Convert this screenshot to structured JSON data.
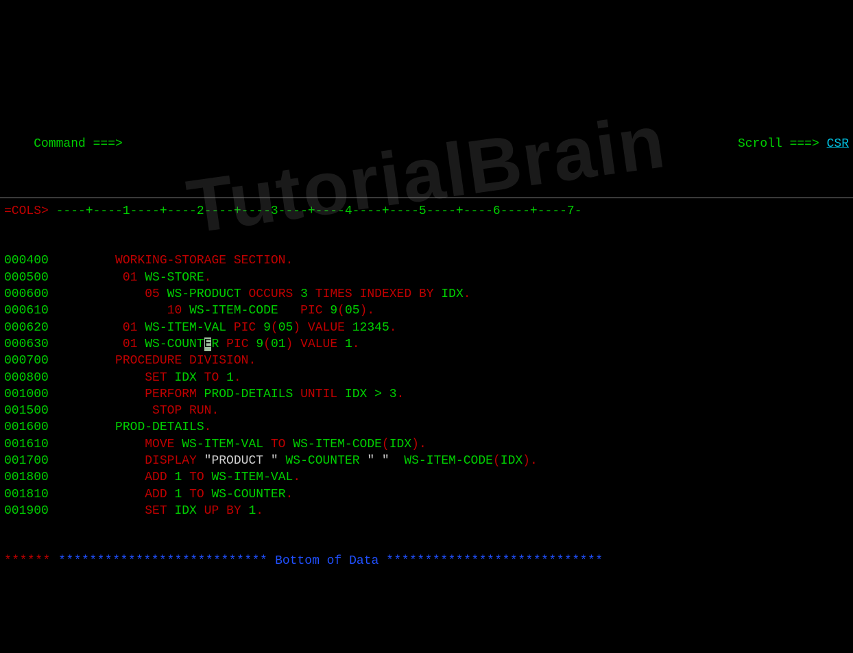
{
  "header": {
    "command_label": "Command ===>",
    "command_value": "",
    "scroll_label": "Scroll ===>",
    "scroll_value": "CSR"
  },
  "cols": {
    "prefix": "=COLS>",
    "ruler": " ----+----1----+----2----+----3----+----4----+----5----+----6----+----7-"
  },
  "lines": [
    {
      "ln": "000400",
      "code": [
        {
          "c": "red",
          "t": "       WORKING-STORAGE SECTION."
        }
      ]
    },
    {
      "ln": "000500",
      "code": [
        {
          "c": "red",
          "t": "        01 "
        },
        {
          "c": "green",
          "t": "WS-STORE"
        },
        {
          "c": "red",
          "t": "."
        }
      ]
    },
    {
      "ln": "000600",
      "code": [
        {
          "c": "red",
          "t": "           05 "
        },
        {
          "c": "green",
          "t": "WS-PRODUCT"
        },
        {
          "c": "red",
          "t": " OCCURS "
        },
        {
          "c": "green",
          "t": "3"
        },
        {
          "c": "red",
          "t": " TIMES INDEXED BY "
        },
        {
          "c": "green",
          "t": "IDX"
        },
        {
          "c": "red",
          "t": "."
        }
      ]
    },
    {
      "ln": "000610",
      "code": [
        {
          "c": "red",
          "t": "              10 "
        },
        {
          "c": "green",
          "t": "WS-ITEM-CODE"
        },
        {
          "c": "red",
          "t": "   PIC "
        },
        {
          "c": "green",
          "t": "9"
        },
        {
          "c": "red",
          "t": "("
        },
        {
          "c": "green",
          "t": "05"
        },
        {
          "c": "red",
          "t": ")."
        }
      ]
    },
    {
      "ln": "000620",
      "code": [
        {
          "c": "red",
          "t": "        01 "
        },
        {
          "c": "green",
          "t": "WS-ITEM-VAL"
        },
        {
          "c": "red",
          "t": " PIC "
        },
        {
          "c": "green",
          "t": "9"
        },
        {
          "c": "red",
          "t": "("
        },
        {
          "c": "green",
          "t": "05"
        },
        {
          "c": "red",
          "t": ") VALUE "
        },
        {
          "c": "green",
          "t": "12345"
        },
        {
          "c": "red",
          "t": "."
        }
      ]
    },
    {
      "ln": "000630",
      "code": [
        {
          "c": "red",
          "t": "        01 "
        },
        {
          "c": "green",
          "t": "WS-COUNT"
        },
        {
          "c": "cursor",
          "t": "E"
        },
        {
          "c": "green",
          "t": "R"
        },
        {
          "c": "red",
          "t": " PIC "
        },
        {
          "c": "green",
          "t": "9"
        },
        {
          "c": "red",
          "t": "("
        },
        {
          "c": "green",
          "t": "01"
        },
        {
          "c": "red",
          "t": ") VALUE "
        },
        {
          "c": "green",
          "t": "1"
        },
        {
          "c": "red",
          "t": "."
        }
      ]
    },
    {
      "ln": "000700",
      "code": [
        {
          "c": "red",
          "t": "       PROCEDURE DIVISION."
        }
      ]
    },
    {
      "ln": "000800",
      "code": [
        {
          "c": "red",
          "t": "           SET "
        },
        {
          "c": "green",
          "t": "IDX"
        },
        {
          "c": "red",
          "t": " TO "
        },
        {
          "c": "green",
          "t": "1"
        },
        {
          "c": "red",
          "t": "."
        }
      ]
    },
    {
      "ln": "001000",
      "code": [
        {
          "c": "red",
          "t": "           PERFORM "
        },
        {
          "c": "green",
          "t": "PROD-DETAILS"
        },
        {
          "c": "red",
          "t": " UNTIL "
        },
        {
          "c": "green",
          "t": "IDX > 3"
        },
        {
          "c": "red",
          "t": "."
        }
      ]
    },
    {
      "ln": "001500",
      "code": [
        {
          "c": "red",
          "t": "            STOP RUN."
        }
      ]
    },
    {
      "ln": "001600",
      "code": [
        {
          "c": "green",
          "t": "       PROD-DETAILS"
        },
        {
          "c": "red",
          "t": "."
        }
      ]
    },
    {
      "ln": "001610",
      "code": [
        {
          "c": "red",
          "t": "           MOVE "
        },
        {
          "c": "green",
          "t": "WS-ITEM-VAL"
        },
        {
          "c": "red",
          "t": " TO "
        },
        {
          "c": "green",
          "t": "WS-ITEM-CODE"
        },
        {
          "c": "red",
          "t": "("
        },
        {
          "c": "green",
          "t": "IDX"
        },
        {
          "c": "red",
          "t": ")."
        }
      ]
    },
    {
      "ln": "001700",
      "code": [
        {
          "c": "red",
          "t": "           DISPLAY "
        },
        {
          "c": "white",
          "t": "\"PRODUCT \""
        },
        {
          "c": "green",
          "t": " WS-COUNTER "
        },
        {
          "c": "white",
          "t": "\" \""
        },
        {
          "c": "green",
          "t": "  WS-ITEM-CODE"
        },
        {
          "c": "red",
          "t": "("
        },
        {
          "c": "green",
          "t": "IDX"
        },
        {
          "c": "red",
          "t": ")."
        }
      ]
    },
    {
      "ln": "001800",
      "code": [
        {
          "c": "red",
          "t": "           ADD "
        },
        {
          "c": "green",
          "t": "1"
        },
        {
          "c": "red",
          "t": " TO "
        },
        {
          "c": "green",
          "t": "WS-ITEM-VAL"
        },
        {
          "c": "red",
          "t": "."
        }
      ]
    },
    {
      "ln": "001810",
      "code": [
        {
          "c": "red",
          "t": "           ADD "
        },
        {
          "c": "green",
          "t": "1"
        },
        {
          "c": "red",
          "t": " TO "
        },
        {
          "c": "green",
          "t": "WS-COUNTER"
        },
        {
          "c": "red",
          "t": "."
        }
      ]
    },
    {
      "ln": "001900",
      "code": [
        {
          "c": "red",
          "t": "           SET "
        },
        {
          "c": "green",
          "t": "IDX"
        },
        {
          "c": "red",
          "t": " UP BY "
        },
        {
          "c": "green",
          "t": "1"
        },
        {
          "c": "red",
          "t": "."
        }
      ]
    }
  ],
  "footer": {
    "stars_prefix": "******",
    "stars_left": " ***************************",
    "bottom_text": " Bottom of Data ",
    "stars_right": "****************************"
  },
  "watermark": "TutorialBrain"
}
